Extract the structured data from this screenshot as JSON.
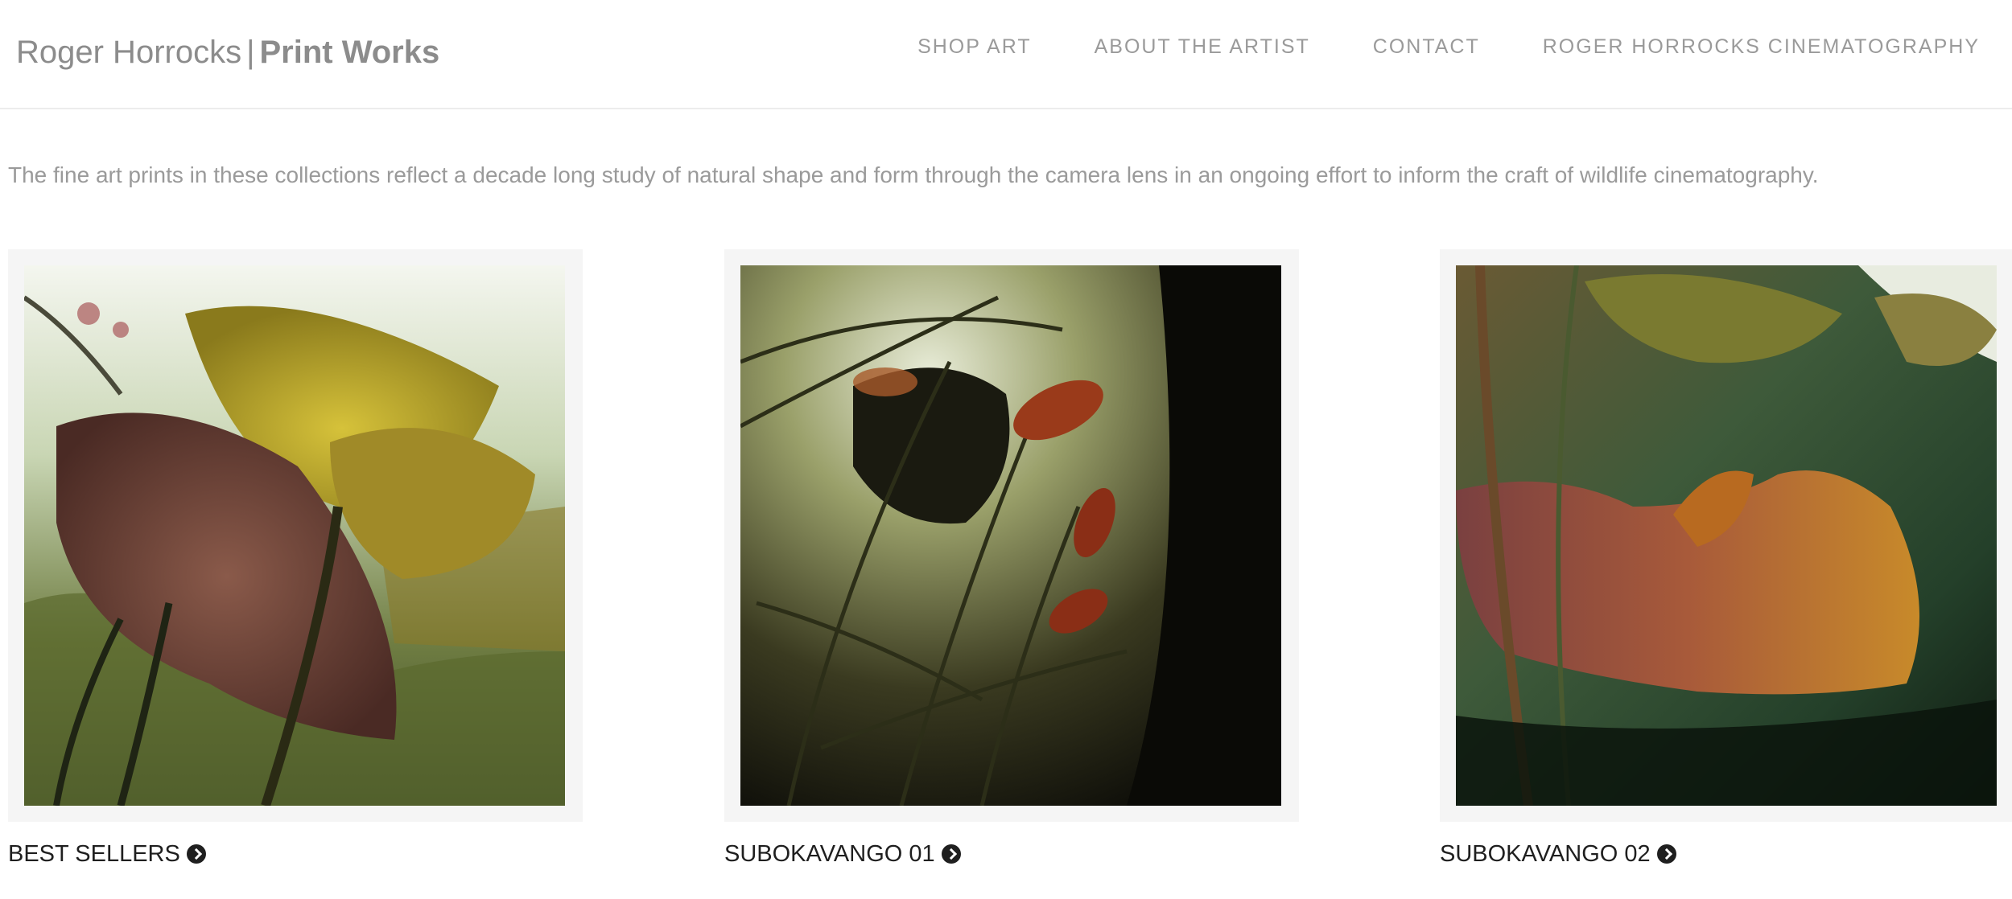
{
  "header": {
    "logo_name": "Roger Horrocks",
    "logo_separator": "|",
    "logo_product": "Print Works",
    "nav": [
      {
        "label": "SHOP ART"
      },
      {
        "label": "ABOUT THE ARTIST"
      },
      {
        "label": "CONTACT"
      },
      {
        "label": "ROGER HORROCKS CINEMATOGRAPHY"
      }
    ]
  },
  "intro": "The fine art prints in these collections reflect a decade long study of natural shape and form through the camera lens in an ongoing effort to inform the craft of wildlife cinematography.",
  "collections": [
    {
      "title": "BEST SELLERS",
      "icon": "chevron-circle-right-icon"
    },
    {
      "title": "SUBOKAVANGO 01",
      "icon": "chevron-circle-right-icon"
    },
    {
      "title": "SUBOKAVANGO 02",
      "icon": "chevron-circle-right-icon"
    }
  ],
  "colors": {
    "text_muted": "#9a9a9a",
    "text_dark": "#1f1f1f",
    "frame_bg": "#f5f5f5"
  }
}
